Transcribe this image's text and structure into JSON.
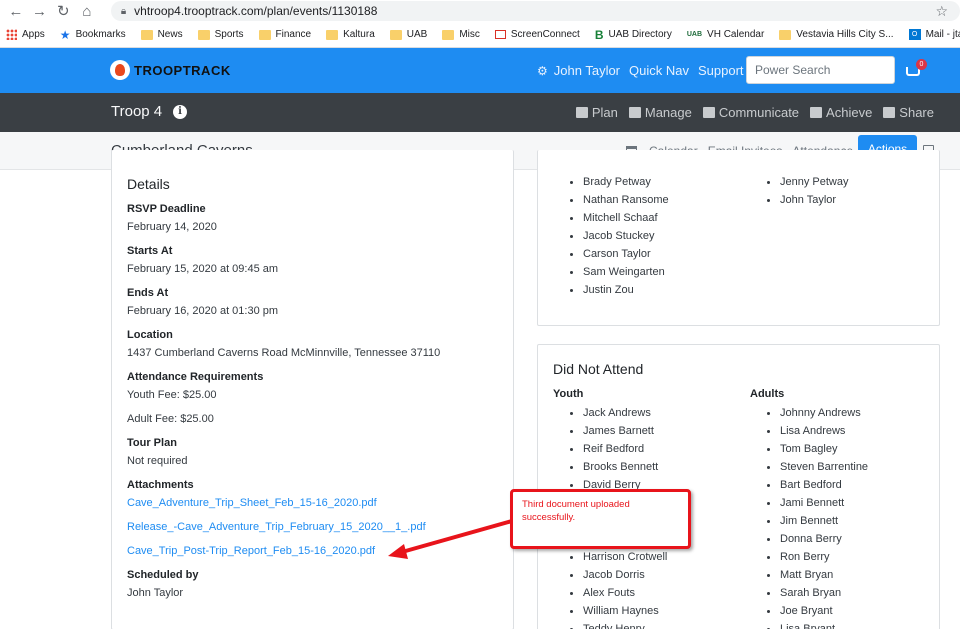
{
  "browser": {
    "url": "vhtroop4.trooptrack.com/plan/events/1130188",
    "bookmarks": [
      "Apps",
      "Bookmarks",
      "News",
      "Sports",
      "Finance",
      "Kaltura",
      "UAB",
      "Misc",
      "ScreenConnect",
      "UAB Directory",
      "VH Calendar",
      "Vestavia Hills City S...",
      "Mail - jtaylor@uab...."
    ]
  },
  "header": {
    "logo": "TROOPTRACK",
    "user": "John Taylor",
    "quick_nav": "Quick Nav",
    "support": "Support",
    "search_placeholder": "Power Search",
    "cart_count": "0"
  },
  "troop": {
    "name": "Troop 4",
    "menu": [
      "Plan",
      "Manage",
      "Communicate",
      "Achieve",
      "Share"
    ]
  },
  "event": {
    "title": "Cumberland Caverns",
    "menu": [
      "Calendar",
      "Email Invitees",
      "Attendance"
    ],
    "actions_label": "Actions"
  },
  "details": {
    "heading": "Details",
    "rsvp_label": "RSVP Deadline",
    "rsvp_value": "February 14, 2020",
    "starts_label": "Starts At",
    "starts_value": "February 15, 2020 at 09:45 am",
    "ends_label": "Ends At",
    "ends_value": "February 16, 2020 at 01:30 pm",
    "location_label": "Location",
    "location_value": "1437 Cumberland Caverns Road McMinnville, Tennessee 37110",
    "attendance_label": "Attendance Requirements",
    "youth_fee": "Youth Fee: $25.00",
    "adult_fee": "Adult Fee: $25.00",
    "tour_label": "Tour Plan",
    "tour_value": "Not required",
    "attachments_label": "Attachments",
    "attachments": [
      "Cave_Adventure_Trip_Sheet_Feb_15-16_2020.pdf",
      "Release_-Cave_Adventure_Trip_February_15_2020__1_.pdf",
      "Cave_Trip_Post-Trip_Report_Feb_15-16_2020.pdf"
    ],
    "scheduled_label": "Scheduled by",
    "scheduled_value": "John Taylor"
  },
  "attended": {
    "youth": [
      "Brady Petway",
      "Nathan Ransome",
      "Mitchell Schaaf",
      "Jacob Stuckey",
      "Carson Taylor",
      "Sam Weingarten",
      "Justin Zou"
    ],
    "adults": [
      "Jenny Petway",
      "John Taylor"
    ]
  },
  "did_not_attend": {
    "heading": "Did Not Attend",
    "youth_label": "Youth",
    "adults_label": "Adults",
    "youth": [
      "Jack Andrews",
      "James Barnett",
      "Reif Bedford",
      "Brooks Bennett",
      "David Berry",
      "",
      "",
      "",
      "Harrison Crotwell",
      "Jacob Dorris",
      "Alex Fouts",
      "William Haynes",
      "Teddy Henry"
    ],
    "adults": [
      "Johnny Andrews",
      "Lisa Andrews",
      "Tom Bagley",
      "Steven Barrentine",
      "Bart Bedford",
      "Jami Bennett",
      "Jim Bennett",
      "Donna Berry",
      "Ron Berry",
      "Matt Bryan",
      "Sarah Bryan",
      "Joe Bryant",
      "Lisa Bryant"
    ]
  },
  "callout": {
    "text": "Third document uploaded successfully."
  },
  "colors": {
    "brand_blue": "#1e8cf2",
    "troop_bar": "#3a3f44",
    "callout_red": "#e8141b"
  }
}
